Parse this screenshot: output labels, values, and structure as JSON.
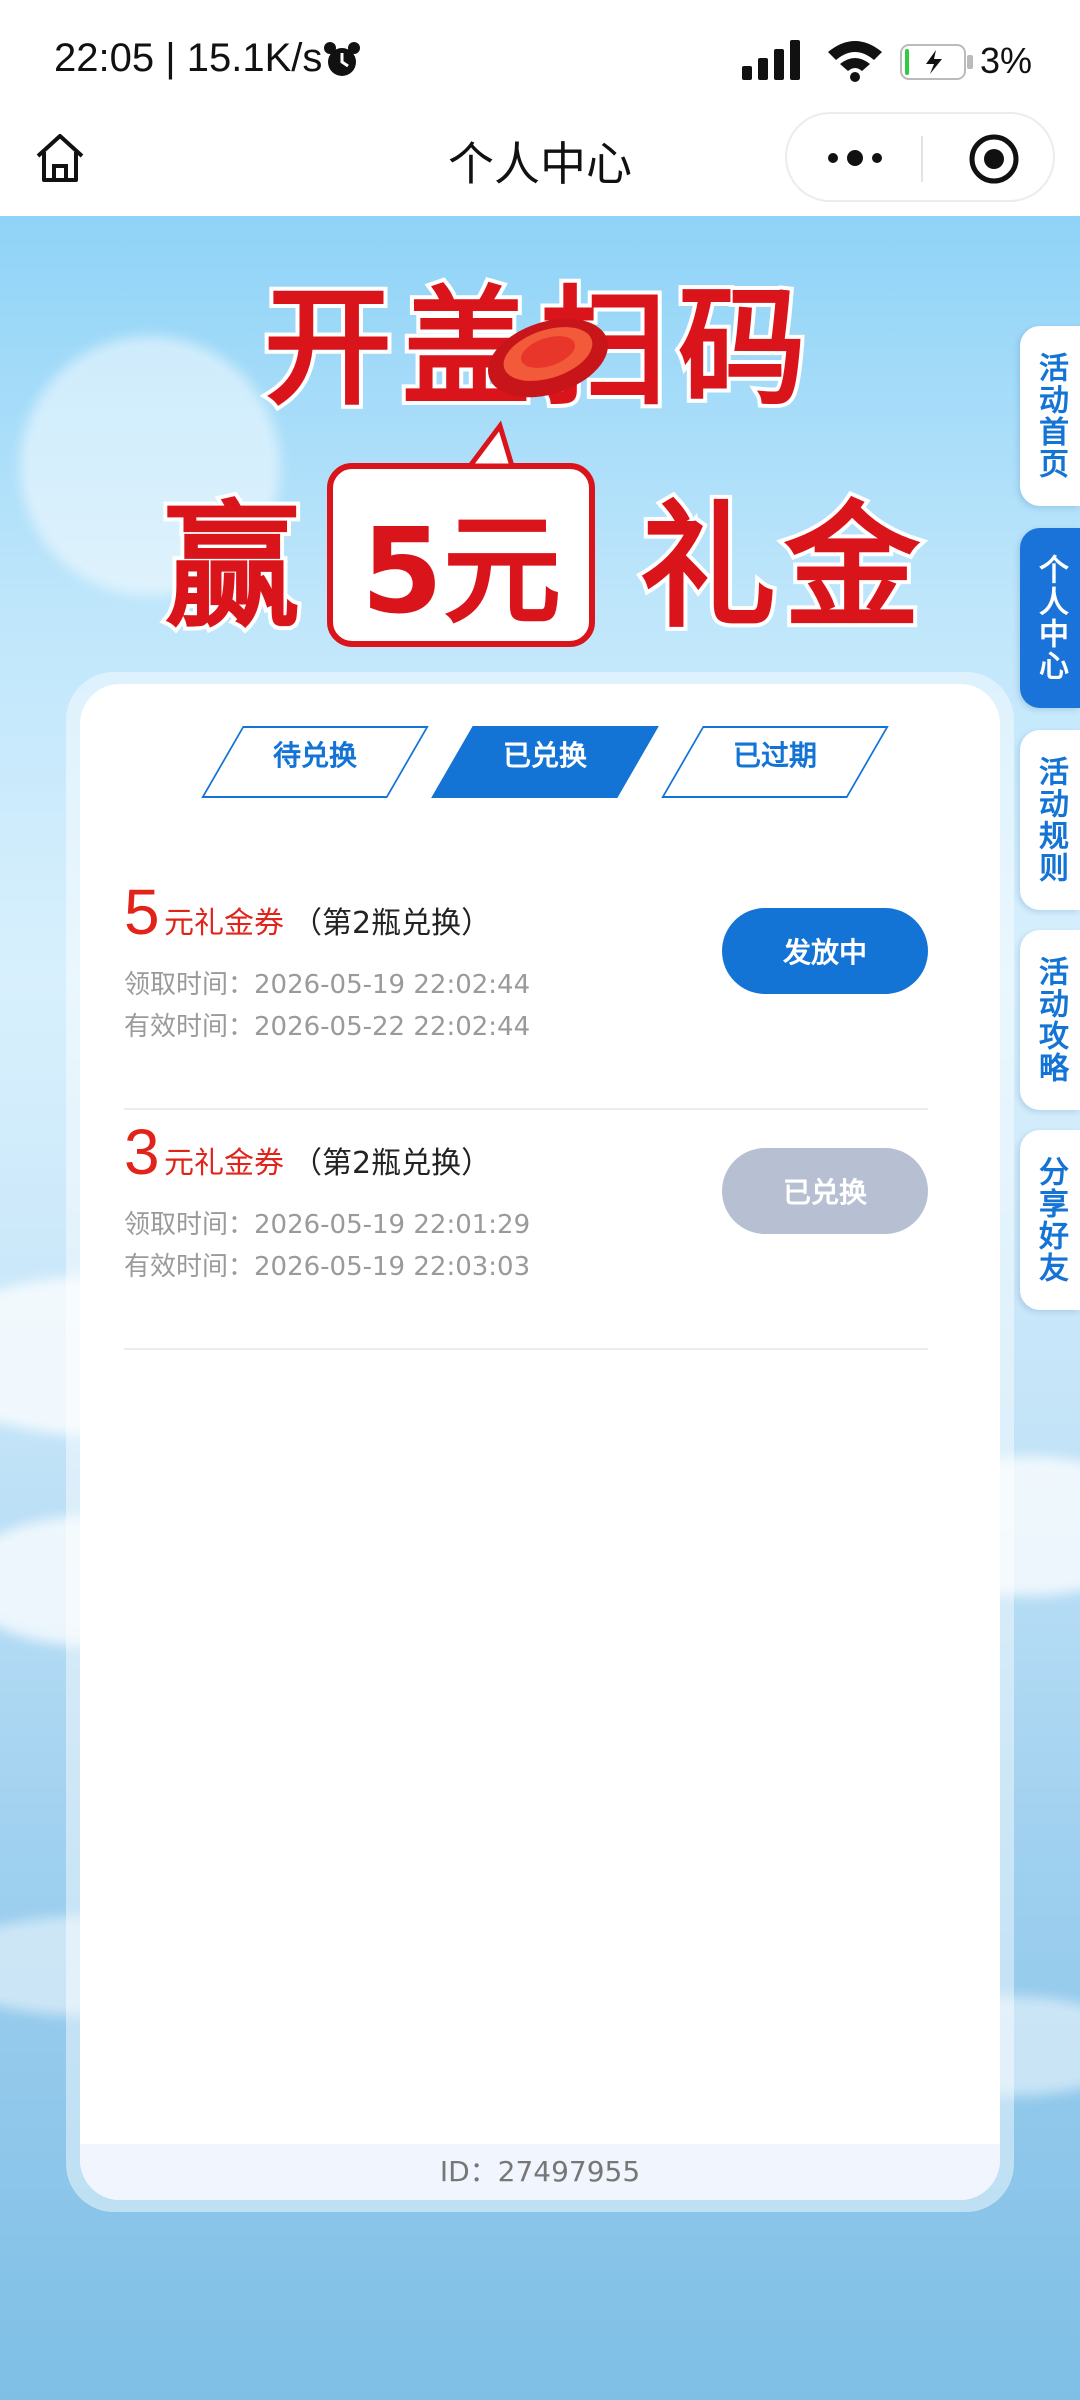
{
  "status_bar": {
    "time": "22:05 | 15.1K/s",
    "battery": "3%",
    "icons": [
      "alarm-icon",
      "signal-icon",
      "wifi-icon",
      "battery-icon"
    ]
  },
  "nav": {
    "title": "个人中心",
    "icons": [
      "home-icon",
      "more-icon",
      "target-icon"
    ]
  },
  "hero": {
    "line1": "开盖扫码",
    "line2_left": "赢",
    "line2_badge": "5元",
    "line2_right": "礼金"
  },
  "side_tabs": [
    {
      "label": "活动首页"
    },
    {
      "label": "个人中心"
    },
    {
      "label": "活动规则"
    },
    {
      "label": "活动攻略"
    },
    {
      "label": "分享好友"
    }
  ],
  "tabs": [
    {
      "label": "待兑换"
    },
    {
      "label": "已兑换"
    },
    {
      "label": "已过期"
    }
  ],
  "coupons": [
    {
      "amount": "5",
      "unit": "元礼金券",
      "note": "（第2瓶兑换）",
      "received": "领取时间：2026-05-19 22:02:44",
      "valid": "有效时间：2026-05-22 22:02:44",
      "status": "发放中"
    },
    {
      "amount": "3",
      "unit": "元礼金券",
      "note": "（第2瓶兑换）",
      "received": "领取时间：2026-05-19 22:01:29",
      "valid": "有效时间：2026-05-19 22:03:03",
      "status": "已兑换"
    }
  ],
  "footer": {
    "id_text": "ID：27497955"
  },
  "colors": {
    "accent": "#1474d6",
    "red": "#e2231a",
    "disabled": "#b6c0d2"
  }
}
